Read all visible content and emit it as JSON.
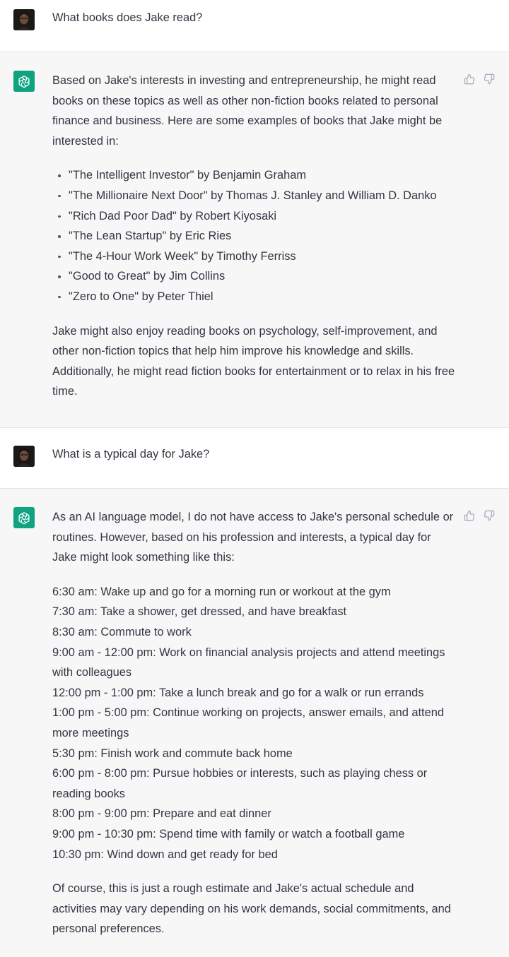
{
  "conversation": [
    {
      "role": "user",
      "text": "What books does Jake read?"
    },
    {
      "role": "assistant",
      "intro": "Based on Jake's interests in investing and entrepreneurship, he might read books on these topics as well as other non-fiction books related to personal finance and business. Here are some examples of books that Jake might be interested in:",
      "books": [
        "\"The Intelligent Investor\" by Benjamin Graham",
        "\"The Millionaire Next Door\" by Thomas J. Stanley and William D. Danko",
        "\"Rich Dad Poor Dad\" by Robert Kiyosaki",
        "\"The Lean Startup\" by Eric Ries",
        "\"The 4-Hour Work Week\" by Timothy Ferriss",
        "\"Good to Great\" by Jim Collins",
        "\"Zero to One\" by Peter Thiel"
      ],
      "outro": "Jake might also enjoy reading books on psychology, self-improvement, and other non-fiction topics that help him improve his knowledge and skills. Additionally, he might read fiction books for entertainment or to relax in his free time."
    },
    {
      "role": "user",
      "text": "What is a typical day for Jake?"
    },
    {
      "role": "assistant",
      "intro": "As an AI language model, I do not have access to Jake's personal schedule or routines. However, based on his profession and interests, a typical day for Jake might look something like this:",
      "schedule": [
        "6:30 am: Wake up and go for a morning run or workout at the gym",
        "7:30 am: Take a shower, get dressed, and have breakfast",
        "8:30 am: Commute to work",
        "9:00 am - 12:00 pm: Work on financial analysis projects and attend meetings with colleagues",
        "12:00 pm - 1:00 pm: Take a lunch break and go for a walk or run errands",
        "1:00 pm - 5:00 pm: Continue working on projects, answer emails, and attend more meetings",
        "5:30 pm: Finish work and commute back home",
        "6:00 pm - 8:00 pm: Pursue hobbies or interests, such as playing chess or reading books",
        "8:00 pm - 9:00 pm: Prepare and eat dinner",
        "9:00 pm - 10:30 pm: Spend time with family or watch a football game",
        "10:30 pm: Wind down and get ready for bed"
      ],
      "outro": "Of course, this is just a rough estimate and Jake's actual schedule and activities may vary depending on his work demands, social commitments, and personal preferences."
    }
  ],
  "icons": {
    "assistant_avatar": "chatgpt-logo-icon",
    "user_avatar": "user-photo-avatar",
    "thumbs_up": "thumbs-up-icon",
    "thumbs_down": "thumbs-down-icon"
  },
  "colors": {
    "assistant_avatar_bg": "#10a37f",
    "user_turn_bg": "#ffffff",
    "assistant_turn_bg": "#f7f7f8",
    "text": "#343541"
  }
}
